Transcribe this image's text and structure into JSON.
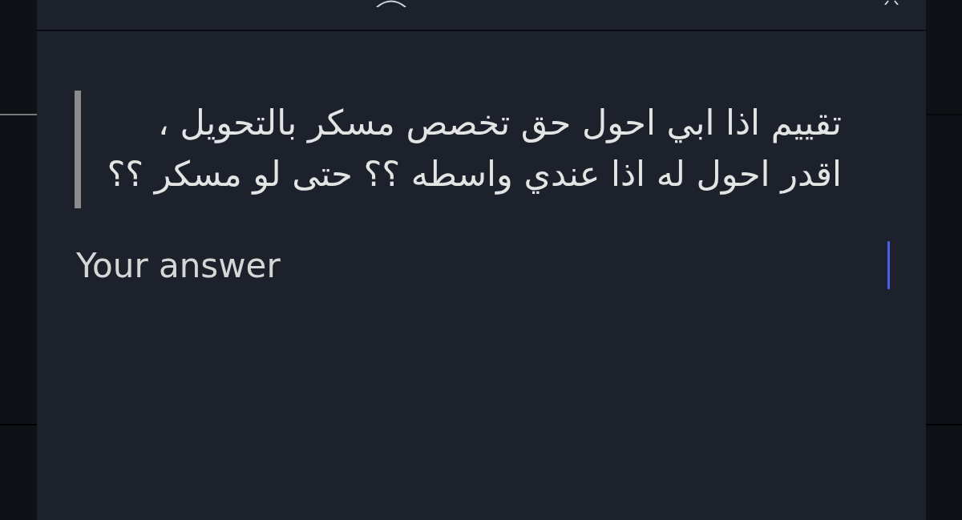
{
  "question": {
    "text": "تقييم اذا ابي احول حق تخصص مسكر بالتحويل ، اقدر احول له اذا عندي واسطه ؟؟ حتى لو مسكر ؟؟"
  },
  "answer": {
    "placeholder": "Your answer",
    "focused": true
  }
}
